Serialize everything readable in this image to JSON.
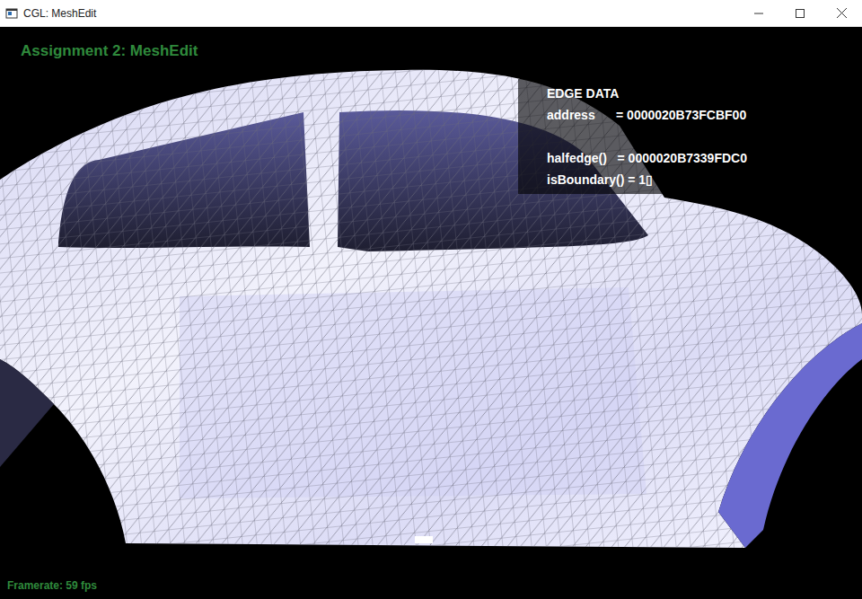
{
  "window": {
    "title": "CGL: MeshEdit"
  },
  "viewport": {
    "heading": "Assignment 2: MeshEdit",
    "framerate": "Framerate: 59 fps"
  },
  "edge_panel": {
    "lines": [
      "EDGE DATA",
      "address      = 0000020B73FCBF00",
      "",
      "halfedge()   = 0000020B7339FDC0",
      "isBoundary() = 1▯"
    ]
  }
}
